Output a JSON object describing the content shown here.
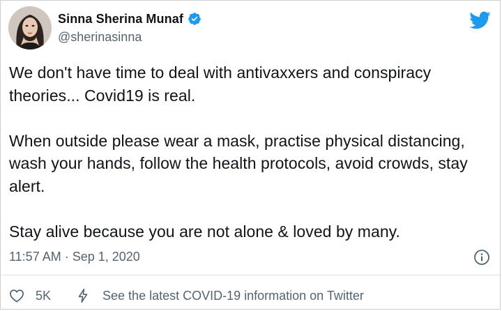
{
  "tweet": {
    "author": {
      "display_name": "Sinna Sherina Munaf",
      "handle": "@sherinasinna",
      "avatar_icon": "profile-photo",
      "verified_icon": "verified-badge-icon",
      "verified_color": "#1d9bf0"
    },
    "brand": {
      "logo_icon": "twitter-bird-icon",
      "color": "#1d9bf0"
    },
    "text": "We don't have time to deal with antivaxxers and conspiracy theories... Covid19 is real.\n\nWhen outside please wear a mask, practise physical distancing, wash your hands, follow the health protocols, avoid crowds, stay alert.\n\nStay alive because you are not alone & loved by many.",
    "timestamp": "11:57 AM · Sep 1, 2020",
    "info_icon": "info-icon",
    "actions": {
      "like_icon": "heart-icon",
      "like_count": "5K",
      "covid_icon": "lightning-bolt-icon",
      "covid_link_label": "See the latest COVID-19 information on Twitter"
    }
  }
}
